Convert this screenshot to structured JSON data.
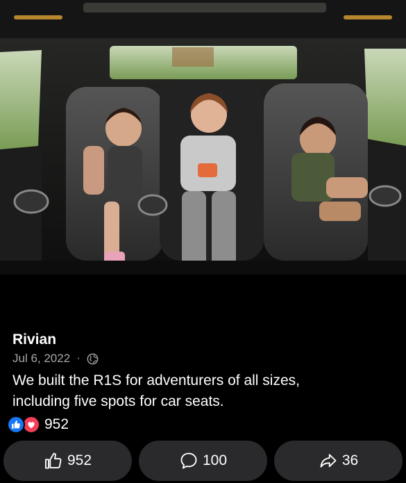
{
  "post": {
    "author": "Rivian",
    "date": "Jul 6, 2022",
    "separator": "·",
    "audience_icon": "globe-icon",
    "caption_line1": "We built the R1S for adventurers of all sizes,",
    "caption_line2": "including five spots for car seats.",
    "image_icon": "photo-of-three-children-in-car-seats"
  },
  "reactions": {
    "icons": [
      "like-reaction-icon",
      "love-reaction-icon"
    ],
    "count": "952"
  },
  "actions": {
    "like": {
      "count": "952",
      "icon": "thumbs-up-icon"
    },
    "comment": {
      "count": "100",
      "icon": "comment-bubble-icon"
    },
    "share": {
      "count": "36",
      "icon": "share-arrow-icon"
    }
  },
  "colors": {
    "background": "#000000",
    "button_bg": "#2a2a2c",
    "like_blue": "#1877f2",
    "love_red": "#f33e58",
    "secondary_text": "#a8a8a8"
  }
}
